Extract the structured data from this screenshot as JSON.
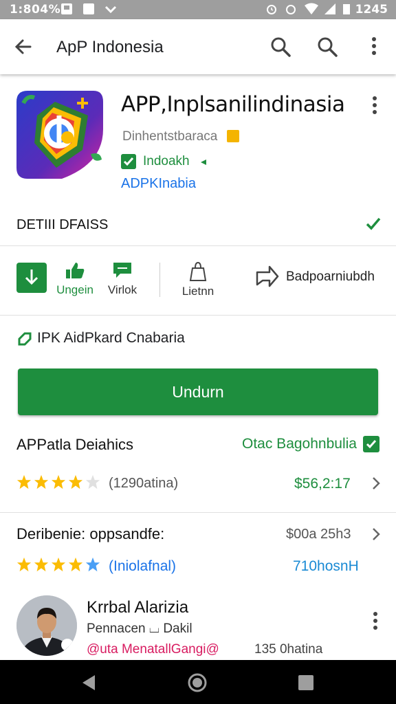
{
  "status_bar": {
    "time_left": "1:804%",
    "time_right": "1245"
  },
  "toolbar": {
    "title": "ApP Indonesia",
    "back_icon": "back-arrow-icon",
    "search_icon": "search-icon",
    "more_icon": "more-vert-icon"
  },
  "app": {
    "name": "APP,Inplsanilindinasia",
    "developer": "Dinhentstbaraca",
    "verified_label": "Indoakh",
    "apk_label": "ADPKInabia",
    "colors": {
      "accent_green": "#1e8e3e",
      "link_blue": "#1a73e8",
      "badge_orange": "#f4b400"
    }
  },
  "details": {
    "label": "DETIII DFAISS"
  },
  "actions": [
    {
      "label": "",
      "icon": "download-icon"
    },
    {
      "label": "Ungein",
      "icon": "thumbs-up-icon"
    },
    {
      "label": "Virlok",
      "icon": "chat-icon"
    },
    {
      "label": "Lietnn",
      "icon": "bag-icon"
    },
    {
      "label": "Badpoarniubdh",
      "icon": "share-icon"
    }
  ],
  "promo": {
    "text": "IPK AidPkard Cnabaria"
  },
  "install_button": {
    "label": "Undurn"
  },
  "rating_section": {
    "title": "APPatla Deiahics",
    "right_label": "Otac Bagohnbulia",
    "stars": 4,
    "count": "(1290atina)",
    "price": "$56,2:17"
  },
  "review_section": {
    "title": "Deribenie: oppsandfe:",
    "right_label": "$00a 25h3",
    "stars": 5,
    "count": "(Iniolafnal)",
    "right_blue": "710hosnH"
  },
  "reviewer": {
    "name": "Krrbal Alarizia",
    "subtitle": "Pennacen ⌴ Dakil",
    "tag": "@uta MenatallGangi@",
    "count": "135 0hatina"
  },
  "nav": {
    "back": "nav-back-icon",
    "home": "nav-home-icon",
    "recents": "nav-recents-icon"
  }
}
